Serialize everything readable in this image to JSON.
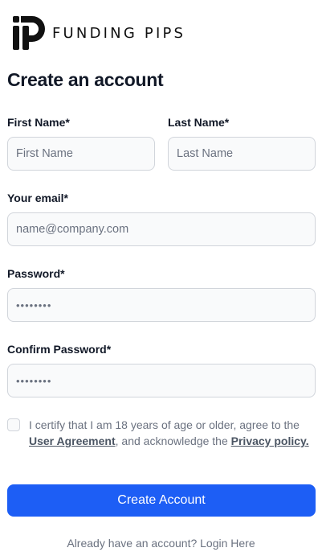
{
  "brand": {
    "name": "FUNDING PIPS",
    "logo_icon": "funding-pips-logo-icon"
  },
  "page": {
    "title": "Create an account"
  },
  "form": {
    "first_name": {
      "label": "First Name*",
      "placeholder": "First Name"
    },
    "last_name": {
      "label": "Last Name*",
      "placeholder": "Last Name"
    },
    "email": {
      "label": "Your email*",
      "placeholder": "name@company.com"
    },
    "password": {
      "label": "Password*",
      "placeholder": "••••••••"
    },
    "confirm_password": {
      "label": "Confirm Password*",
      "placeholder": "••••••••"
    },
    "terms": {
      "prefix": "I certify that I am 18 years of age or older, agree to the",
      "user_agreement": " User Agreement",
      "middle": ", and acknowledge the ",
      "privacy_policy": "Privacy policy."
    },
    "submit_label": "Create Account"
  },
  "footer": {
    "login_text": "Already have an account? Login Here"
  },
  "colors": {
    "primary": "#1d5ef5",
    "input_bg": "#f9fafb",
    "input_border": "#d1d5db",
    "muted_text": "#6b7280"
  }
}
